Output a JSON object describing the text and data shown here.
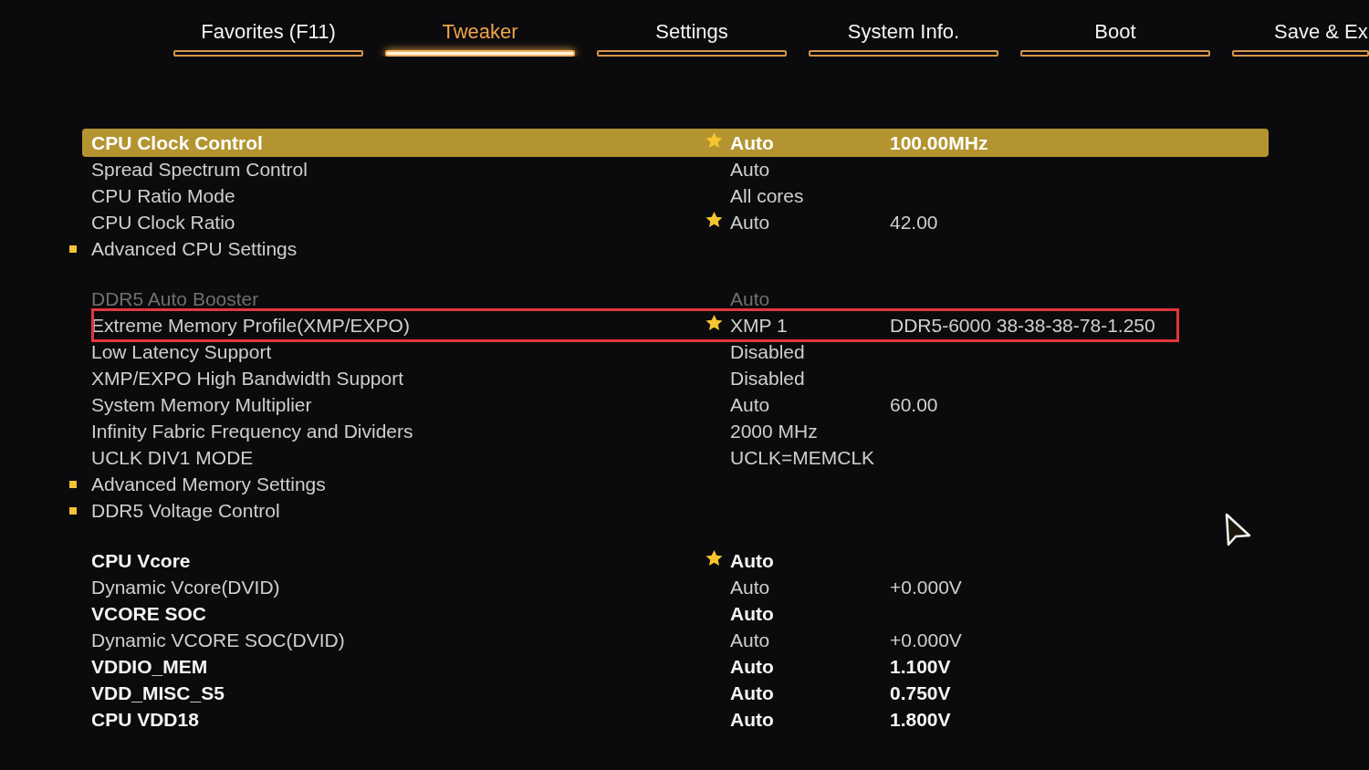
{
  "tabs": [
    {
      "label": "Favorites (F11)",
      "selected": false
    },
    {
      "label": "Tweaker",
      "selected": true
    },
    {
      "label": "Settings",
      "selected": false
    },
    {
      "label": "System Info.",
      "selected": false
    },
    {
      "label": "Boot",
      "selected": false
    },
    {
      "label": "Save & Ex",
      "selected": false
    }
  ],
  "sections": [
    {
      "rows": [
        {
          "kind": "setting",
          "label": "CPU Clock Control",
          "value": "Auto",
          "column_3": "100.00MHz",
          "selected": true,
          "starred": true,
          "outlined": false,
          "dimmed": false,
          "bold": true
        },
        {
          "kind": "setting",
          "label": "Spread Spectrum Control",
          "value": "Auto",
          "selected": false,
          "starred": false,
          "outlined": false,
          "dimmed": false,
          "bold": false
        },
        {
          "kind": "setting",
          "label": "CPU Ratio Mode",
          "value": "All cores",
          "selected": false,
          "starred": false,
          "outlined": false,
          "dimmed": false,
          "bold": false
        },
        {
          "kind": "setting",
          "label": "CPU Clock Ratio",
          "value": "Auto",
          "column_3": "42.00",
          "selected": false,
          "starred": true,
          "outlined": false,
          "dimmed": false,
          "bold": false
        },
        {
          "kind": "submenu",
          "label": "Advanced CPU Settings",
          "selected": false,
          "starred": false,
          "outlined": false,
          "dimmed": false,
          "bold": false
        }
      ]
    },
    {
      "rows": [
        {
          "kind": "setting",
          "label": "DDR5 Auto Booster",
          "value": "Auto",
          "selected": false,
          "starred": false,
          "outlined": false,
          "dimmed": true,
          "bold": false
        },
        {
          "kind": "setting",
          "label": "Extreme Memory Profile(XMP/EXPO)",
          "value": "XMP 1",
          "column_3": "DDR5-6000 38-38-38-78-1.250",
          "selected": false,
          "starred": true,
          "outlined": true,
          "dimmed": false,
          "bold": false
        },
        {
          "kind": "setting",
          "label": "Low Latency Support",
          "value": "Disabled",
          "selected": false,
          "starred": false,
          "outlined": false,
          "dimmed": false,
          "bold": false
        },
        {
          "kind": "setting",
          "label": "XMP/EXPO High Bandwidth Support",
          "value": "Disabled",
          "selected": false,
          "starred": false,
          "outlined": false,
          "dimmed": false,
          "bold": false
        },
        {
          "kind": "setting",
          "label": "System Memory Multiplier",
          "value": "Auto",
          "column_3": "60.00",
          "selected": false,
          "starred": false,
          "outlined": false,
          "dimmed": false,
          "bold": false
        },
        {
          "kind": "setting",
          "label": "Infinity Fabric Frequency and Dividers",
          "value": "2000 MHz",
          "selected": false,
          "starred": false,
          "outlined": false,
          "dimmed": false,
          "bold": false
        },
        {
          "kind": "setting",
          "label": "UCLK DIV1 MODE",
          "value": "UCLK=MEMCLK",
          "selected": false,
          "starred": false,
          "outlined": false,
          "dimmed": false,
          "bold": false
        },
        {
          "kind": "submenu",
          "label": "Advanced Memory Settings",
          "selected": false,
          "starred": false,
          "outlined": false,
          "dimmed": false,
          "bold": false
        },
        {
          "kind": "submenu",
          "label": "DDR5 Voltage Control",
          "selected": false,
          "starred": false,
          "outlined": false,
          "dimmed": false,
          "bold": false
        }
      ]
    },
    {
      "rows": [
        {
          "kind": "setting",
          "label": "CPU Vcore",
          "value": "Auto",
          "selected": false,
          "starred": true,
          "outlined": false,
          "dimmed": false,
          "bold": true
        },
        {
          "kind": "setting",
          "label": "Dynamic Vcore(DVID)",
          "value": "Auto",
          "column_3": "+0.000V",
          "selected": false,
          "starred": false,
          "outlined": false,
          "dimmed": false,
          "bold": false
        },
        {
          "kind": "setting",
          "label": "VCORE SOC",
          "value": "Auto",
          "selected": false,
          "starred": false,
          "outlined": false,
          "dimmed": false,
          "bold": true
        },
        {
          "kind": "setting",
          "label": "Dynamic VCORE SOC(DVID)",
          "value": "Auto",
          "column_3": "+0.000V",
          "selected": false,
          "starred": false,
          "outlined": false,
          "dimmed": false,
          "bold": false
        },
        {
          "kind": "setting",
          "label": "VDDIO_MEM",
          "value": "Auto",
          "column_3": "1.100V",
          "selected": false,
          "starred": false,
          "outlined": false,
          "dimmed": false,
          "bold": true
        },
        {
          "kind": "setting",
          "label": "VDD_MISC_S5",
          "value": "Auto",
          "column_3": "0.750V",
          "selected": false,
          "starred": false,
          "outlined": false,
          "dimmed": false,
          "bold": true
        },
        {
          "kind": "setting",
          "label": "CPU VDD18",
          "value": "Auto",
          "column_3": "1.800V",
          "selected": false,
          "starred": false,
          "outlined": false,
          "dimmed": false,
          "bold": true
        }
      ]
    }
  ]
}
